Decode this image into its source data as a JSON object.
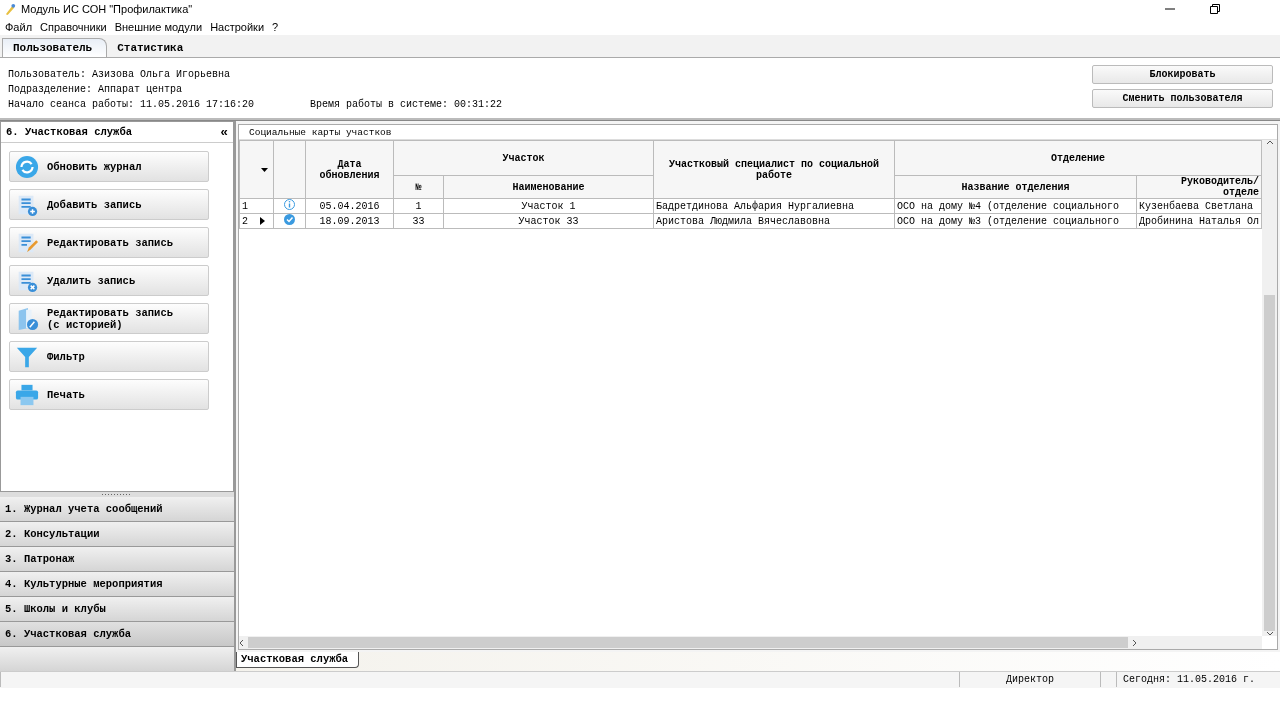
{
  "window": {
    "title": "Модуль ИС СОН \"Профилактика\""
  },
  "menu": [
    {
      "label": "Файл"
    },
    {
      "label": "Справочники"
    },
    {
      "label": "Внешние модули"
    },
    {
      "label": "Настройки"
    },
    {
      "label": "?"
    }
  ],
  "tabs": [
    {
      "label": "Пользователь",
      "selected": true
    },
    {
      "label": "Статистика",
      "selected": false
    }
  ],
  "user_info": {
    "user": "Пользователь: Азизова Ольга Игорьевна",
    "department": "Подразделение: Аппарат центра",
    "session_start": "Начало сеанса работы: 11.05.2016 17:16:20",
    "work_time": "Время работы в системе: 00:31:22"
  },
  "user_buttons": [
    "Блокировать",
    "Сменить пользователя"
  ],
  "sidebar": {
    "title": "6. Участковая служба",
    "collapse": "«",
    "actions": [
      {
        "kind": "refresh",
        "label": "Обновить журнал"
      },
      {
        "kind": "add",
        "label": "Добавить запись"
      },
      {
        "kind": "edit",
        "label": "Редактировать запись"
      },
      {
        "kind": "delete",
        "label": "Удалить запись"
      },
      {
        "kind": "history",
        "label": "Редактировать запись\n(с историей)"
      },
      {
        "kind": "filter",
        "label": "Фильтр"
      },
      {
        "kind": "print",
        "label": "Печать"
      }
    ],
    "sections": [
      {
        "label": "1. Журнал учета сообщений",
        "selected": false
      },
      {
        "label": "2. Консультации",
        "selected": false
      },
      {
        "label": "3. Патронаж",
        "selected": false
      },
      {
        "label": "4. Культурные мероприятия",
        "selected": false
      },
      {
        "label": "5. Школы и клубы",
        "selected": false
      },
      {
        "label": "6. Участковая служба",
        "selected": true
      }
    ]
  },
  "group": {
    "title": "Социальные карты участков"
  },
  "table": {
    "headers": {
      "date": "Дата обновления",
      "area": "Участок",
      "area_no": "№",
      "area_name": "Наименование",
      "specialist": "Участковый специалист по социальной работе",
      "department": "Отделение",
      "dept_name": "Название отделения",
      "dept_head": "Руководитель/\nотделе"
    },
    "rows": [
      {
        "num": "1",
        "kind": "info",
        "current": false,
        "date": "05.04.2016",
        "no": "1",
        "name": "Участок 1",
        "specialist": "Бадретдинова Альфария Нургалиевна",
        "dept_name": "ОСО на дому №4 (отделение социального",
        "dept_head": "Кузенбаева Светлана"
      },
      {
        "num": "2",
        "kind": "check",
        "current": true,
        "date": "18.09.2013",
        "no": "33",
        "name": "Участок 33",
        "specialist": "Аристова Людмила Вячеславовна",
        "dept_name": "ОСО на дому №3 (отделение социального",
        "dept_head": "Дробинина Наталья Ол"
      }
    ]
  },
  "bottom_tabs": [
    {
      "label": "Участковая служба",
      "selected": true
    }
  ],
  "status_bar": {
    "role": "Директор",
    "today": "Сегодня: 11.05.2016 г."
  }
}
